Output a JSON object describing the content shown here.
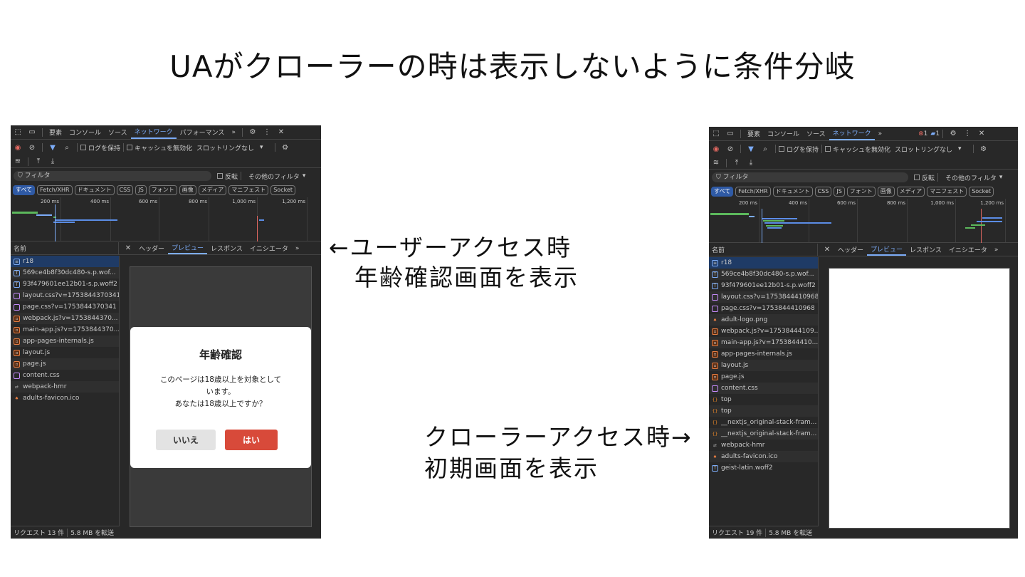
{
  "title": "UAがクローラーの時は表示しないように条件分岐",
  "annotations": {
    "user_line1": "←ユーザーアクセス時",
    "user_line2": "年齢確認画面を表示",
    "crawler_line1": "クローラーアクセス時→",
    "crawler_line2": "初期画面を表示"
  },
  "left": {
    "tabs": [
      "要素",
      "コンソール",
      "ソース",
      "ネットワーク",
      "パフォーマンス"
    ],
    "active_tab": "ネットワーク",
    "more": "»",
    "options": {
      "preserve_log": "ログを保持",
      "disable_cache": "キャッシュを無効化",
      "throttle": "スロットリングなし"
    },
    "filter_placeholder": "フィルタ",
    "invert": "反転",
    "other_filters": "その他のフィルタ",
    "chips": [
      "すべて",
      "Fetch/XHR",
      "ドキュメント",
      "CSS",
      "JS",
      "フォント",
      "画像",
      "メディア",
      "マニフェスト",
      "Socket"
    ],
    "ticks": [
      "200 ms",
      "400 ms",
      "600 ms",
      "800 ms",
      "1,000 ms",
      "1,200 ms"
    ],
    "name_header": "名前",
    "detail_tabs": [
      "ヘッダー",
      "プレビュー",
      "レスポンス",
      "イニシエータ"
    ],
    "active_detail": "プレビュー",
    "files": [
      {
        "name": "r18",
        "type": "doc"
      },
      {
        "name": "569ce4b8f30dc480-s.p.wof...",
        "type": "font"
      },
      {
        "name": "93f479601ee12b01-s.p.woff2",
        "type": "font"
      },
      {
        "name": "layout.css?v=1753844370341",
        "type": "css"
      },
      {
        "name": "page.css?v=1753844370341",
        "type": "css"
      },
      {
        "name": "webpack.js?v=1753844370...",
        "type": "js"
      },
      {
        "name": "main-app.js?v=1753844370...",
        "type": "js"
      },
      {
        "name": "app-pages-internals.js",
        "type": "js"
      },
      {
        "name": "layout.js",
        "type": "js"
      },
      {
        "name": "page.js",
        "type": "js"
      },
      {
        "name": "content.css",
        "type": "css"
      },
      {
        "name": "webpack-hmr",
        "type": "ws"
      },
      {
        "name": "adults-favicon.ico",
        "type": "img"
      }
    ],
    "status_requests": "リクエスト 13 件",
    "status_transfer": "5.8 MB を転送",
    "modal": {
      "title": "年齢確認",
      "line1": "このページは18歳以上を対象として",
      "line2": "います。",
      "line3": "あなたは18歳以上ですか？",
      "no": "いいえ",
      "yes": "はい"
    }
  },
  "right": {
    "tabs": [
      "要素",
      "コンソール",
      "ソース",
      "ネットワーク"
    ],
    "active_tab": "ネットワーク",
    "more": "»",
    "errors": "1",
    "messages": "1",
    "options": {
      "preserve_log": "ログを保持",
      "disable_cache": "キャッシュを無効化",
      "throttle": "スロットリングなし"
    },
    "filter_placeholder": "フィルタ",
    "invert": "反転",
    "other_filters": "その他のフィルタ",
    "chips": [
      "すべて",
      "Fetch/XHR",
      "ドキュメント",
      "CSS",
      "JS",
      "フォント",
      "画像",
      "メディア",
      "マニフェスト",
      "Socket"
    ],
    "ticks": [
      "200 ms",
      "400 ms",
      "600 ms",
      "800 ms",
      "1,000 ms",
      "1,200 ms"
    ],
    "name_header": "名前",
    "detail_tabs": [
      "ヘッダー",
      "プレビュー",
      "レスポンス",
      "イニシエータ"
    ],
    "active_detail": "プレビュー",
    "files": [
      {
        "name": "r18",
        "type": "doc"
      },
      {
        "name": "569ce4b8f30dc480-s.p.wof...",
        "type": "font"
      },
      {
        "name": "93f479601ee12b01-s.p.woff2",
        "type": "font"
      },
      {
        "name": "layout.css?v=1753844410968",
        "type": "css"
      },
      {
        "name": "page.css?v=1753844410968",
        "type": "css"
      },
      {
        "name": "adult-logo.png",
        "type": "img"
      },
      {
        "name": "webpack.js?v=17538444109...",
        "type": "js"
      },
      {
        "name": "main-app.js?v=1753844410...",
        "type": "js"
      },
      {
        "name": "app-pages-internals.js",
        "type": "js"
      },
      {
        "name": "layout.js",
        "type": "js"
      },
      {
        "name": "page.js",
        "type": "js"
      },
      {
        "name": "content.css",
        "type": "css"
      },
      {
        "name": "top",
        "type": "fetch"
      },
      {
        "name": "top",
        "type": "fetch"
      },
      {
        "name": "__nextjs_original-stack-fram...",
        "type": "fetch"
      },
      {
        "name": "__nextjs_original-stack-fram...",
        "type": "fetch"
      },
      {
        "name": "webpack-hmr",
        "type": "ws"
      },
      {
        "name": "adults-favicon.ico",
        "type": "img"
      },
      {
        "name": "geist-latin.woff2",
        "type": "font"
      }
    ],
    "status_requests": "リクエスト 19 件",
    "status_transfer": "5.8 MB を転送"
  }
}
